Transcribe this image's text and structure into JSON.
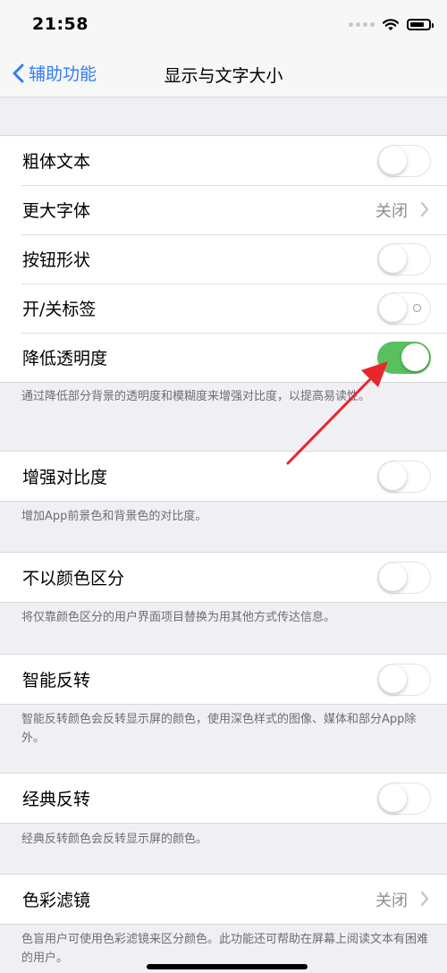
{
  "status": {
    "time": "21:58"
  },
  "nav": {
    "back_label": "辅助功能",
    "title": "显示与文字大小"
  },
  "rows": {
    "bold_text": {
      "label": "粗体文本",
      "on": false
    },
    "larger_text": {
      "label": "更大字体",
      "value": "关闭"
    },
    "button_shapes": {
      "label": "按钮形状",
      "on": false
    },
    "onoff_labels": {
      "label": "开/关标签",
      "on": false
    },
    "reduce_transparency": {
      "label": "降低透明度",
      "on": true,
      "footnote": "通过降低部分背景的透明度和模糊度来增强对比度，以提高易读性。"
    },
    "increase_contrast": {
      "label": "增强对比度",
      "on": false,
      "footnote": "增加App前景色和背景色的对比度。"
    },
    "differentiate_without_color": {
      "label": "不以颜色区分",
      "on": false,
      "footnote": "将仅靠颜色区分的用户界面项目替换为用其他方式传达信息。"
    },
    "smart_invert": {
      "label": "智能反转",
      "on": false,
      "footnote": "智能反转颜色会反转显示屏的颜色，使用深色样式的图像、媒体和部分App除外。"
    },
    "classic_invert": {
      "label": "经典反转",
      "on": false,
      "footnote": "经典反转颜色会反转显示屏的颜色。"
    },
    "color_filters": {
      "label": "色彩滤镜",
      "value": "关闭",
      "footnote": "色盲用户可使用色彩滤镜来区分颜色。此功能还可帮助在屏幕上阅读文本有困难的用户。"
    }
  },
  "colors": {
    "accent": "#2f7cf6",
    "toggle_on": "#5ac05e",
    "annotation_arrow": "#e8262b"
  }
}
